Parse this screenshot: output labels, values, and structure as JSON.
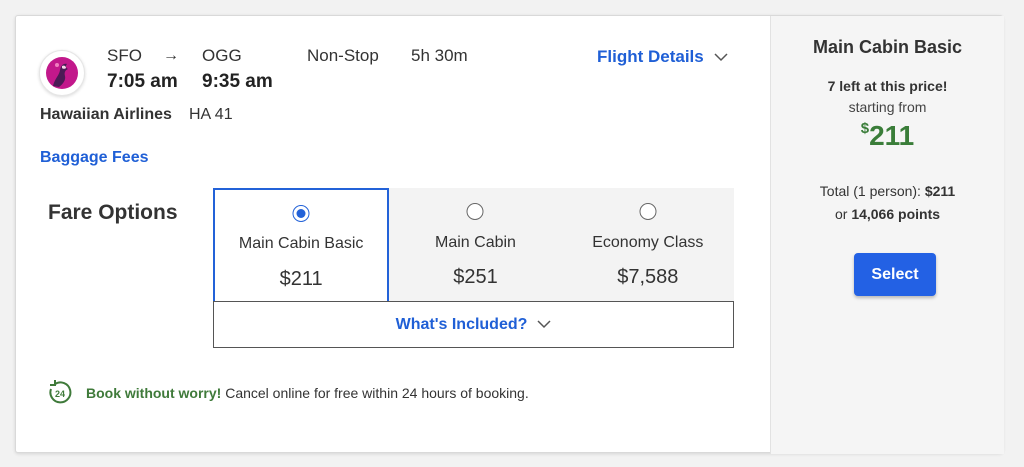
{
  "flight": {
    "origin_code": "SFO",
    "destination_code": "OGG",
    "depart_time": "7:05 am",
    "arrive_time": "9:35 am",
    "stops": "Non-Stop",
    "duration": "5h 30m",
    "airline": "Hawaiian Airlines",
    "flight_number": "HA 41",
    "details_label": "Flight Details",
    "baggage_label": "Baggage Fees"
  },
  "fare_options": {
    "title": "Fare Options",
    "options": [
      {
        "name": "Main Cabin Basic",
        "price": "$211",
        "selected": true
      },
      {
        "name": "Main Cabin",
        "price": "$251",
        "selected": false
      },
      {
        "name": "Economy Class",
        "price": "$7,588",
        "selected": false
      }
    ],
    "included_label": "What's Included?"
  },
  "notice": {
    "bold": "Book without worry!",
    "text": " Cancel online for free within 24 hours of booking.",
    "icon_label": "24"
  },
  "summary": {
    "title": "Main Cabin Basic",
    "seats_left": "7 left at this price!",
    "starting_from": "starting from",
    "currency": "$",
    "price": "211",
    "total_label": "Total (1 person): ",
    "total_value": "$211",
    "points_prefix": "or ",
    "points_value": "14,066 points",
    "select_label": "Select"
  },
  "colors": {
    "link": "#1f5fd6",
    "accent": "#2362d8",
    "price_green": "#3a7d39",
    "button": "#2361e4"
  }
}
